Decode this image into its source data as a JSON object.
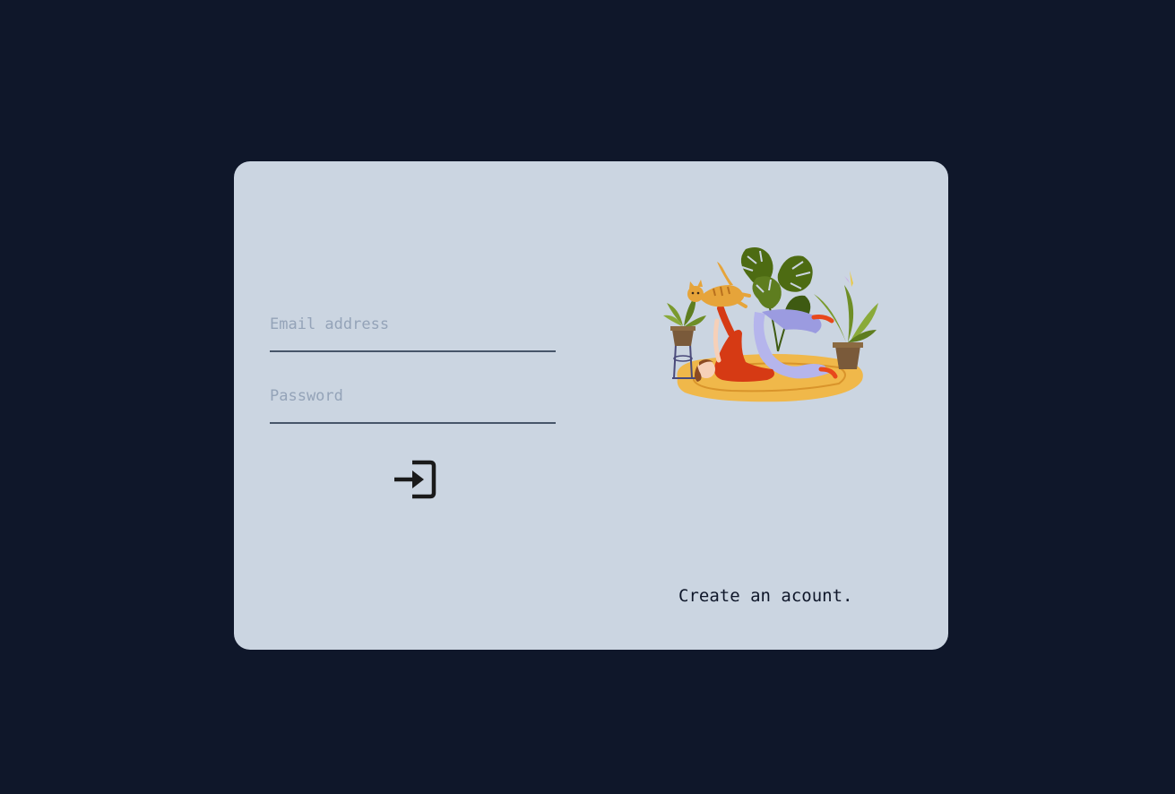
{
  "login": {
    "email_placeholder": "Email address",
    "password_placeholder": "Password",
    "login_icon": "login-icon"
  },
  "aside": {
    "illustration_icon": "woman-with-cat-and-plants-illustration",
    "create_account_label": "Create an acount."
  },
  "colors": {
    "background": "#0f172a",
    "card": "#cbd5e1",
    "underline": "#475569",
    "text": "#0f172a"
  }
}
